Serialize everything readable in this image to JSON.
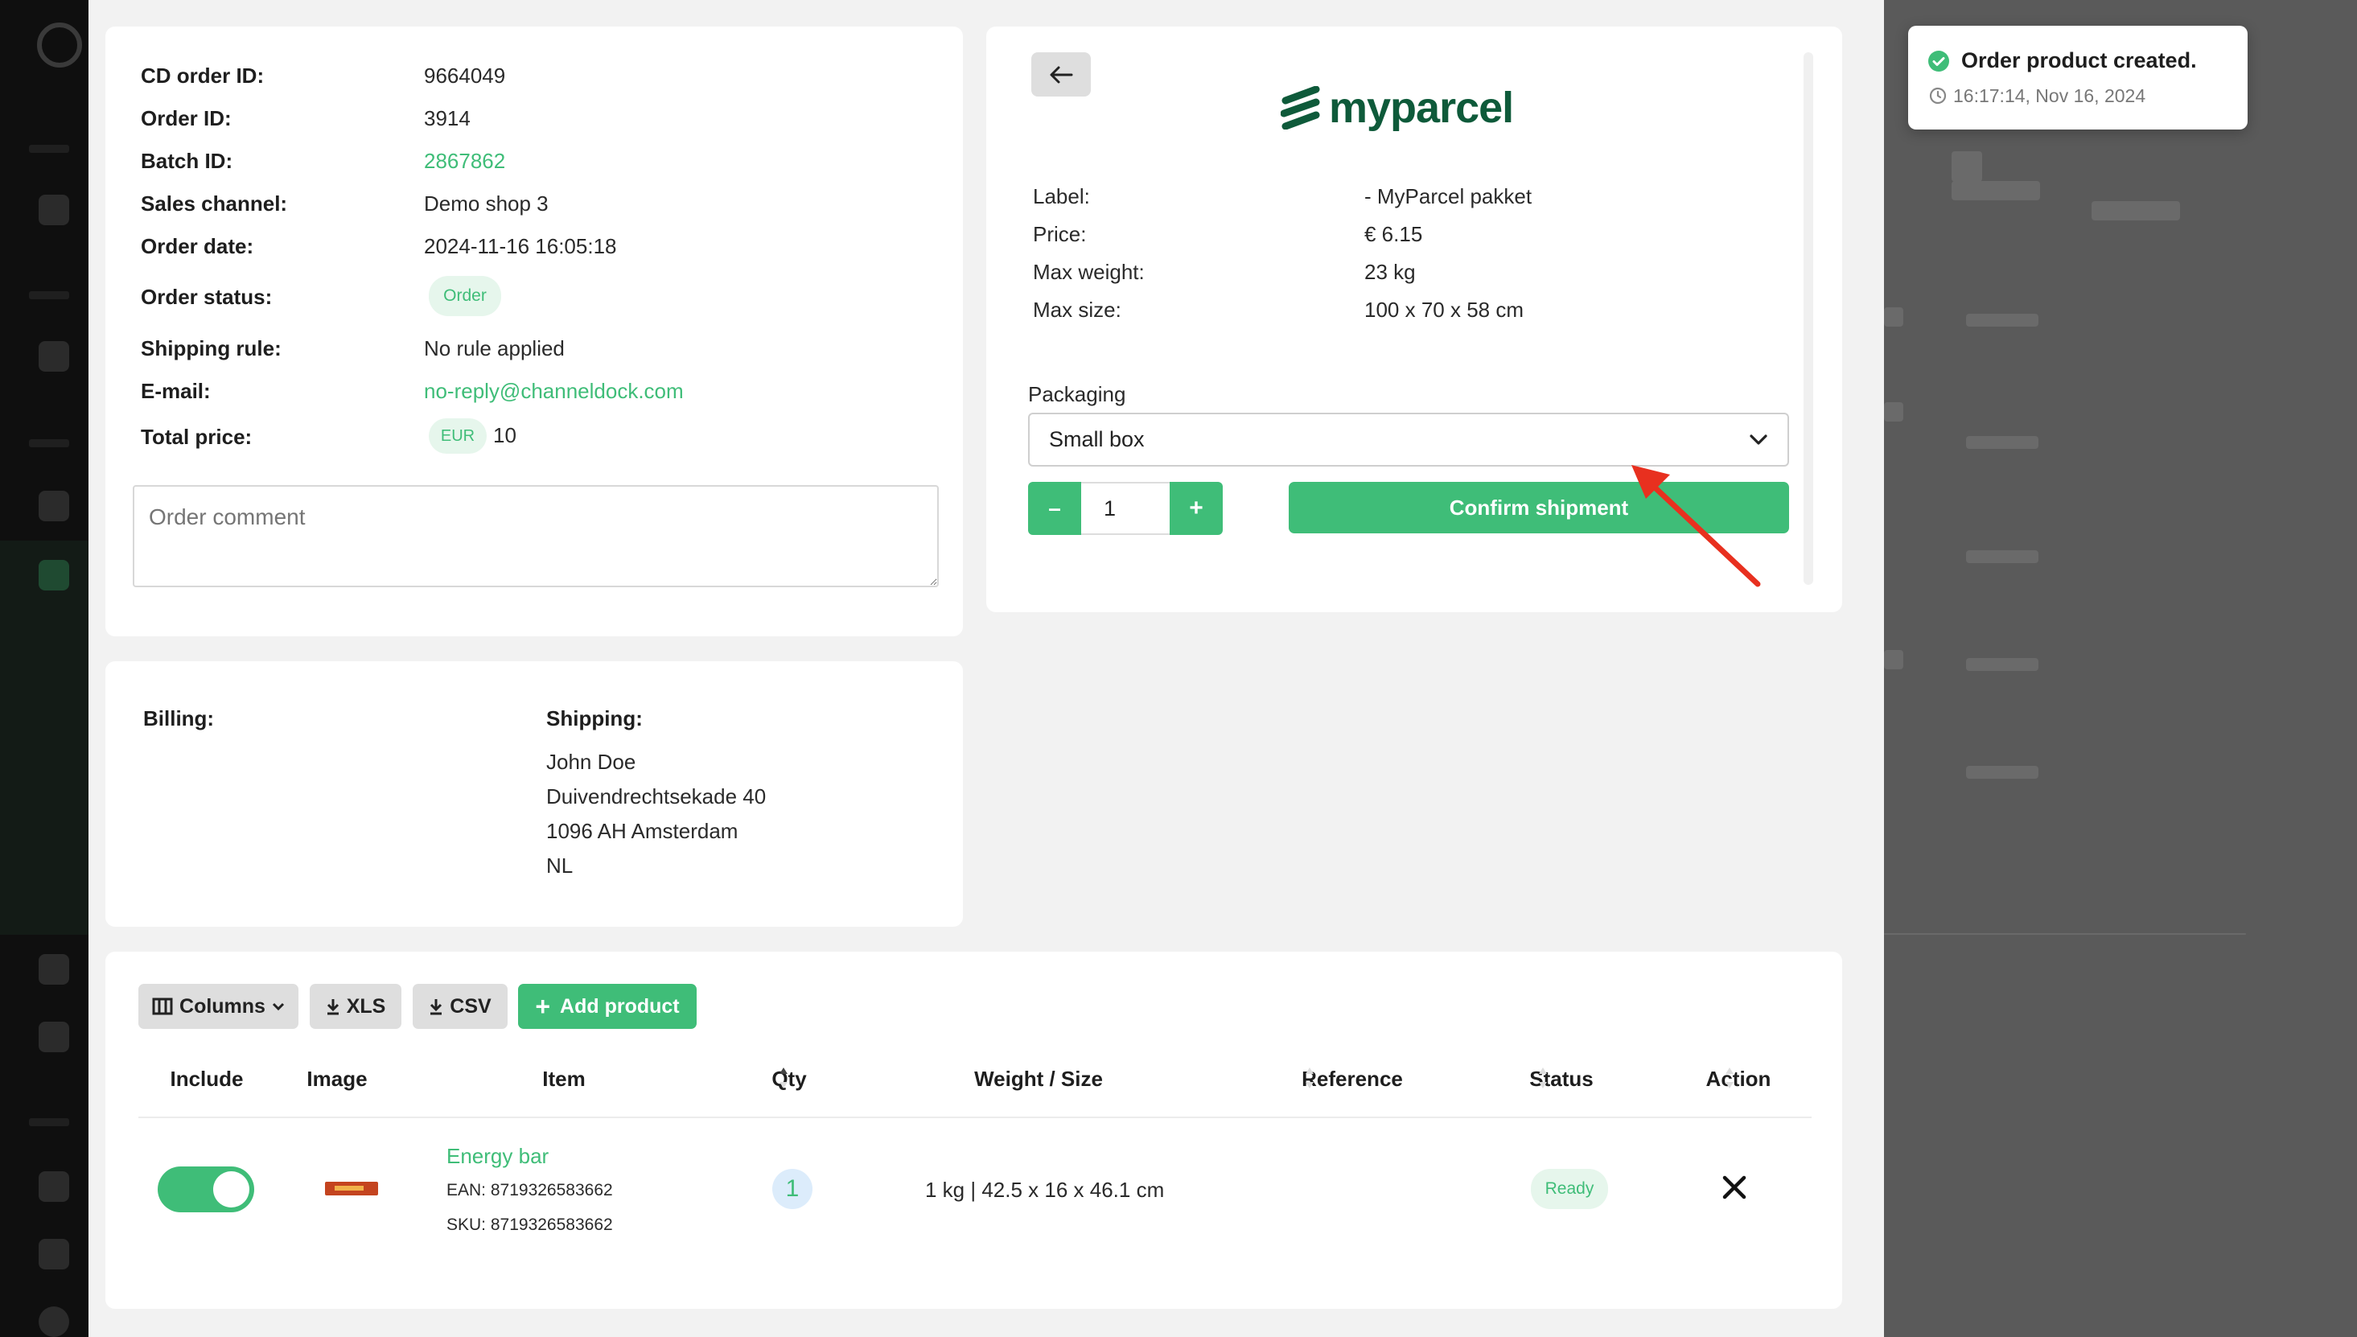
{
  "sidebar": {
    "icons": [
      "panel-icon",
      "cart-icon",
      "box-icon",
      "shipment-icon",
      "inbox-icon",
      "sync-icon",
      "grid-icon",
      "chat-icon",
      "avatar-icon"
    ]
  },
  "order": {
    "fields": [
      {
        "label": "CD order ID:",
        "value": "9664049"
      },
      {
        "label": "Order ID:",
        "value": "3914"
      },
      {
        "label": "Batch ID:",
        "value": "2867862"
      },
      {
        "label": "Sales channel:",
        "value": "Demo shop 3"
      },
      {
        "label": "Order date:",
        "value": "2024-11-16 16:05:18"
      },
      {
        "label": "Order status:",
        "value": "Order"
      },
      {
        "label": "Shipping rule:",
        "value": "No rule applied"
      },
      {
        "label": "E-mail:",
        "value": "no-reply@channeldock.com"
      },
      {
        "label": "Total price:",
        "currency": "EUR",
        "value": "10"
      }
    ],
    "comment_placeholder": "Order comment"
  },
  "address": {
    "billing_label": "Billing:",
    "shipping_label": "Shipping:",
    "shipping_lines": [
      "John Doe",
      "Duivendrechtsekade 40",
      "1096 AH Amsterdam",
      "NL"
    ]
  },
  "shipment": {
    "brand": "myparcel",
    "rows": [
      {
        "label": "Label:",
        "value": "- MyParcel pakket"
      },
      {
        "label": "Price:",
        "value": "€ 6.15"
      },
      {
        "label": "Max weight:",
        "value": "23 kg"
      },
      {
        "label": "Max size:",
        "value": "100 x 70 x 58 cm"
      }
    ],
    "packaging_label": "Packaging",
    "packaging_value": "Small box",
    "quantity": "1",
    "minus": "–",
    "plus": "+",
    "confirm_label": "Confirm shipment"
  },
  "products": {
    "toolbar": {
      "columns": "Columns",
      "xls": "XLS",
      "csv": "CSV",
      "add": "Add product"
    },
    "headers": [
      "Include",
      "Image",
      "Item",
      "Qty",
      "Weight / Size",
      "Reference",
      "Status",
      "Action"
    ],
    "rows": [
      {
        "name": "Energy bar",
        "ean": "EAN: 8719326583662",
        "sku": "SKU: 8719326583662",
        "qty": "1",
        "weight_size": "1 kg | 42.5 x 16 x 46.1 cm",
        "reference": "",
        "status": "Ready",
        "include": true
      }
    ]
  },
  "toast": {
    "title": "Order product created.",
    "time": "16:17:14, Nov 16, 2024"
  },
  "colors": {
    "accent": "#3fbd78",
    "annotation_arrow": "#e8301f",
    "myparcel_brand": "#0e5a3a"
  }
}
